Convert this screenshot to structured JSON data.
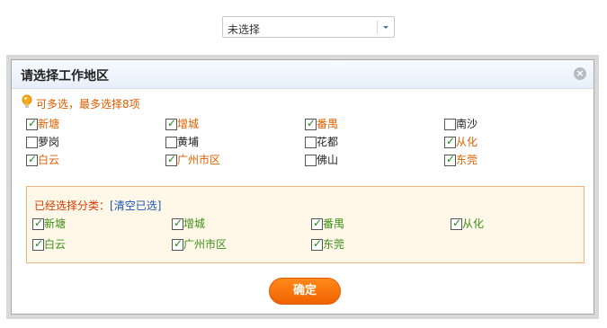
{
  "top_select": {
    "value": "未选择"
  },
  "dialog": {
    "title": "请选择工作地区",
    "close_glyph": "×",
    "hint": "可多选，最多选择8项",
    "regions": [
      {
        "label": "新塘",
        "checked": true
      },
      {
        "label": "增城",
        "checked": true
      },
      {
        "label": "番禺",
        "checked": true
      },
      {
        "label": "南沙",
        "checked": false
      },
      {
        "label": "萝岗",
        "checked": false
      },
      {
        "label": "黄埔",
        "checked": false
      },
      {
        "label": "花都",
        "checked": false
      },
      {
        "label": "从化",
        "checked": true
      },
      {
        "label": "白云",
        "checked": true
      },
      {
        "label": "广州市区",
        "checked": true
      },
      {
        "label": "佛山",
        "checked": false
      },
      {
        "label": "东莞",
        "checked": true
      }
    ],
    "selected_panel": {
      "title": "已经选择分类：",
      "clear_label": "[清空已选]",
      "items": [
        "新塘",
        "增城",
        "番禺",
        "从化",
        "白云",
        "广州市区",
        "东莞"
      ]
    },
    "confirm_label": "确定"
  },
  "colors": {
    "accent_orange": "#f06200",
    "checked_label": "#e06000",
    "selected_label": "#3d8f1a",
    "link_blue": "#1a55b8"
  }
}
